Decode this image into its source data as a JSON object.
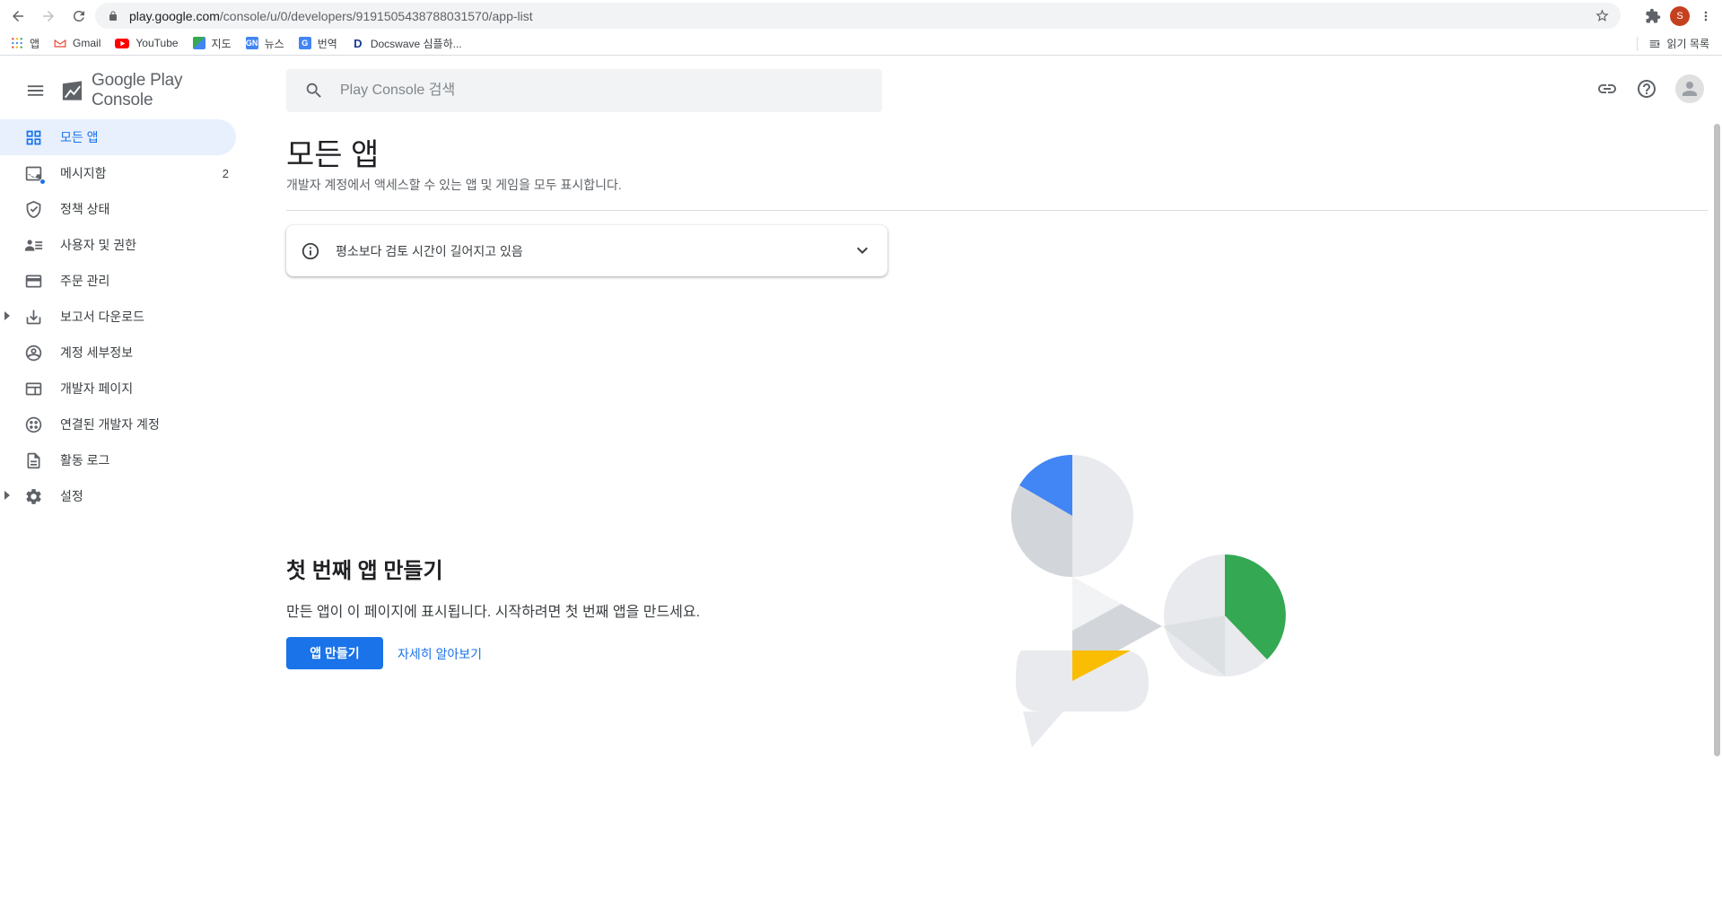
{
  "browser": {
    "url_host": "play.google.com",
    "url_path": "/console/u/0/developers/9191505438788031570/app-list",
    "profile_initial": "S",
    "bookmarks": [
      {
        "label": "앱",
        "icon": "apps-grid-icon"
      },
      {
        "label": "Gmail",
        "icon": "gmail-icon"
      },
      {
        "label": "YouTube",
        "icon": "youtube-icon"
      },
      {
        "label": "지도",
        "icon": "maps-icon"
      },
      {
        "label": "뉴스",
        "icon": "news-icon"
      },
      {
        "label": "번역",
        "icon": "translate-icon"
      },
      {
        "label": "Docswave 심플하...",
        "icon": "docswave-icon"
      }
    ],
    "reading_list": "읽기 목록"
  },
  "brand": {
    "google": "Google",
    "play": "Play",
    "console": "Console"
  },
  "sidebar": {
    "items": [
      {
        "label": "모든 앱",
        "icon": "grid-icon",
        "active": true
      },
      {
        "label": "메시지함",
        "icon": "inbox-icon",
        "count": "2"
      },
      {
        "label": "정책 상태",
        "icon": "shield-check-icon"
      },
      {
        "label": "사용자 및 권한",
        "icon": "users-icon"
      },
      {
        "label": "주문 관리",
        "icon": "credit-card-icon"
      },
      {
        "label": "보고서 다운로드",
        "icon": "download-icon",
        "expandable": true
      },
      {
        "label": "계정 세부정보",
        "icon": "account-circle-icon"
      },
      {
        "label": "개발자 페이지",
        "icon": "web-page-icon"
      },
      {
        "label": "연결된 개발자 계정",
        "icon": "linked-accounts-icon"
      },
      {
        "label": "활동 로그",
        "icon": "document-icon"
      },
      {
        "label": "설정",
        "icon": "gear-icon",
        "expandable": true
      }
    ]
  },
  "search": {
    "placeholder": "Play Console 검색"
  },
  "main": {
    "title": "모든 앱",
    "subtitle": "개발자 계정에서 액세스할 수 있는 앱 및 게임을 모두 표시합니다.",
    "notice": "평소보다 검토 시간이 길어지고 있음",
    "empty_title": "첫 번째 앱 만들기",
    "empty_desc": "만든 앱이 이 페이지에 표시됩니다. 시작하려면 첫 번째 앱을 만드세요.",
    "create_button": "앱 만들기",
    "learn_more": "자세히 알아보기"
  },
  "colors": {
    "accent": "#1a73e8",
    "active_bg": "#e8f0fe",
    "illus_blue": "#4285f4",
    "illus_green": "#34a853",
    "illus_yellow": "#fbbc04",
    "illus_gray": "#dadce0"
  }
}
